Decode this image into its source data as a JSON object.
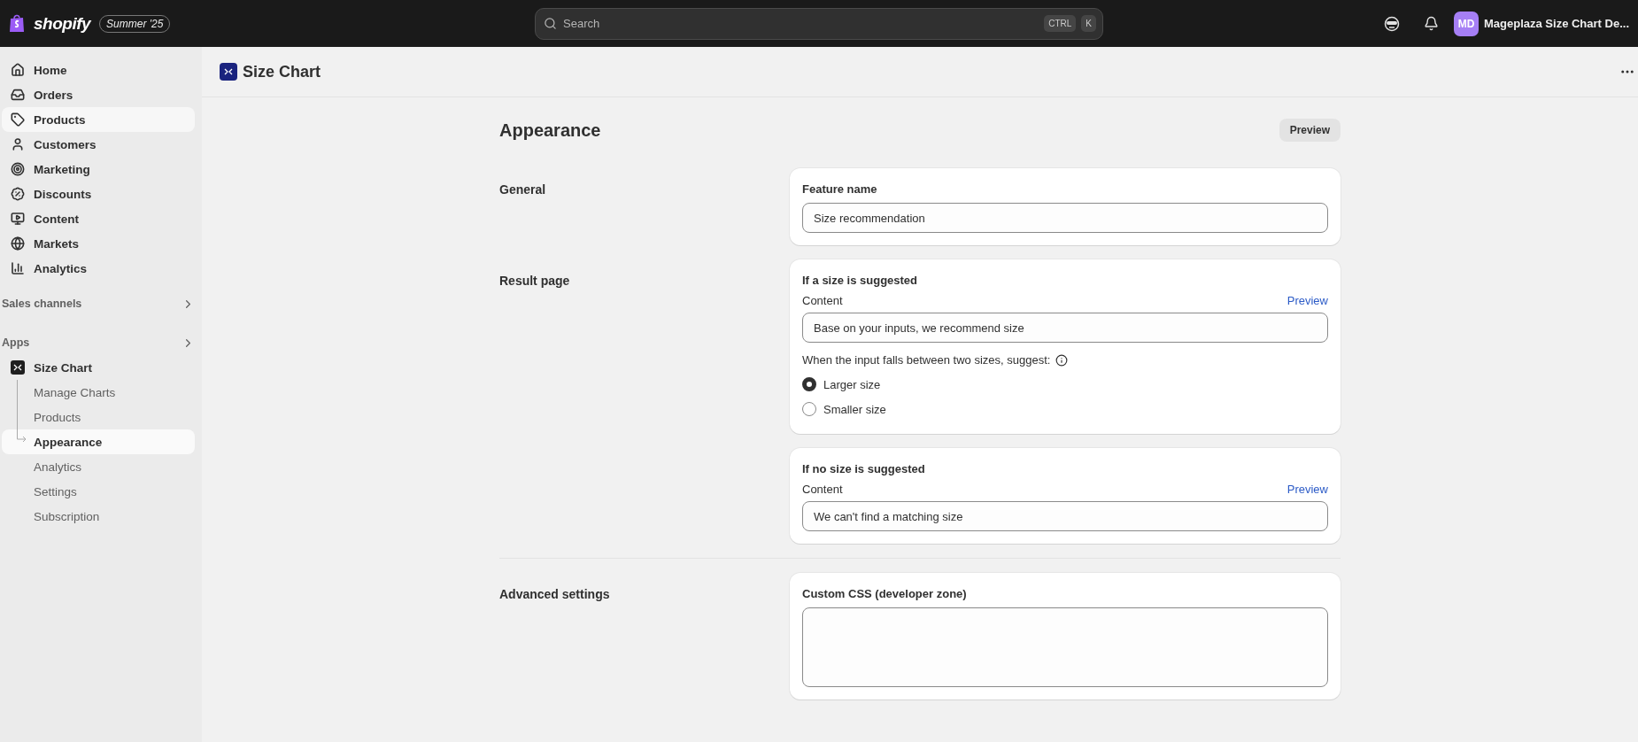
{
  "top_bar": {
    "logo": "shopify",
    "edition_badge": "Summer '25",
    "search": {
      "placeholder": "Search",
      "shortcut_keys": [
        "CTRL",
        "K"
      ]
    },
    "store": {
      "initials": "MD",
      "name": "Mageplaza Size Chart De..."
    }
  },
  "sidebar": {
    "items": [
      {
        "label": "Home",
        "highlighted": false
      },
      {
        "label": "Orders",
        "highlighted": false
      },
      {
        "label": "Products",
        "highlighted": true
      },
      {
        "label": "Customers",
        "highlighted": false
      },
      {
        "label": "Marketing",
        "highlighted": false
      },
      {
        "label": "Discounts",
        "highlighted": false
      },
      {
        "label": "Content",
        "highlighted": false
      },
      {
        "label": "Markets",
        "highlighted": false
      },
      {
        "label": "Analytics",
        "highlighted": false
      }
    ],
    "sections": [
      {
        "label": "Sales channels"
      },
      {
        "label": "Apps"
      }
    ],
    "app": {
      "label": "Size Chart",
      "children": [
        {
          "label": "Manage Charts",
          "selected": false
        },
        {
          "label": "Products",
          "selected": false
        },
        {
          "label": "Appearance",
          "selected": true
        },
        {
          "label": "Analytics",
          "selected": false
        },
        {
          "label": "Settings",
          "selected": false
        },
        {
          "label": "Subscription",
          "selected": false
        }
      ]
    }
  },
  "page": {
    "title": "Size Chart",
    "heading": "Appearance",
    "preview_button": "Preview",
    "sections": [
      {
        "label": "General",
        "divider_before": false,
        "cards": [
          {
            "kind": "input",
            "title": "Feature name",
            "value": "Size recommendation"
          }
        ]
      },
      {
        "label": "Result page",
        "divider_before": false,
        "cards": [
          {
            "kind": "input",
            "title": "If a size is suggested",
            "field_label": "Content",
            "link": "Preview",
            "value": "Base on your inputs, we recommend size",
            "question": "When the input falls between two sizes, suggest:",
            "options": [
              {
                "label": "Larger size",
                "selected": true
              },
              {
                "label": "Smaller size",
                "selected": false
              }
            ]
          },
          {
            "kind": "input",
            "title": "If no size is suggested",
            "field_label": "Content",
            "link": "Preview",
            "value": "We can't find a matching size"
          }
        ]
      },
      {
        "label": "Advanced settings",
        "divider_before": true,
        "cards": [
          {
            "kind": "textarea",
            "title": "Custom CSS (developer zone)"
          }
        ]
      }
    ]
  }
}
